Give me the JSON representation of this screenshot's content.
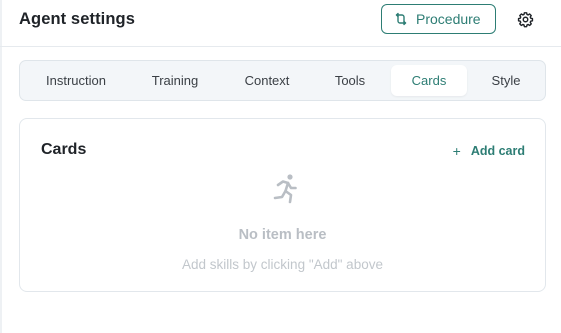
{
  "header": {
    "title": "Agent settings",
    "procedure_label": "Procedure",
    "procedure_icon": "flow-icon",
    "settings_icon": "gear-icon"
  },
  "tabs": [
    {
      "label": "Instruction",
      "active": false
    },
    {
      "label": "Training",
      "active": false
    },
    {
      "label": "Context",
      "active": false
    },
    {
      "label": "Tools",
      "active": false
    },
    {
      "label": "Cards",
      "active": true
    },
    {
      "label": "Style",
      "active": false
    }
  ],
  "cards_panel": {
    "title": "Cards",
    "add_label": "Add card",
    "add_icon": "+",
    "empty_icon": "running-person-icon",
    "empty_title": "No item here",
    "empty_subtitle": "Add skills by clicking \"Add\" above"
  },
  "colors": {
    "accent": "#2d7d74",
    "tab_bar_bg": "#f3f6f9",
    "muted_text": "#b9bec4"
  }
}
